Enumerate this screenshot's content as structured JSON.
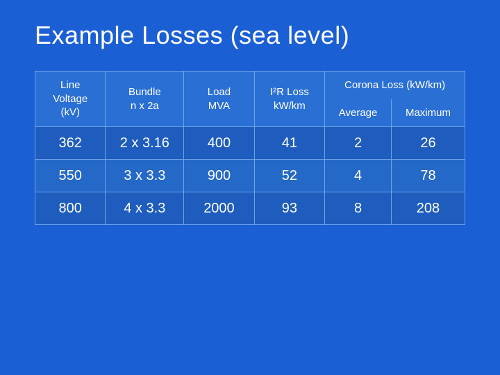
{
  "page": {
    "title": "Example Losses (sea level)"
  },
  "table": {
    "headers": {
      "line_voltage": "Line\nVoltage (kV)",
      "bundle": "Bundle\nn x 2a",
      "load_mva": "Load\nMVA",
      "i2r_loss": "I²R Loss\nkW/km",
      "corona_loss": "Corona Loss (kW/km)",
      "average": "Average",
      "maximum": "Maximum"
    },
    "rows": [
      {
        "line_voltage": "362",
        "bundle": "2 x 3.16",
        "load_mva": "400",
        "i2r_loss": "41",
        "average": "2",
        "maximum": "26"
      },
      {
        "line_voltage": "550",
        "bundle": "3 x 3.3",
        "load_mva": "900",
        "i2r_loss": "52",
        "average": "4",
        "maximum": "78"
      },
      {
        "line_voltage": "800",
        "bundle": "4 x 3.3",
        "load_mva": "2000",
        "i2r_loss": "93",
        "average": "8",
        "maximum": "208"
      }
    ]
  }
}
